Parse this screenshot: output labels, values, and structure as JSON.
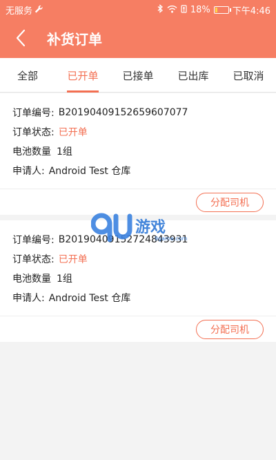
{
  "status_bar": {
    "carrier": "无服务",
    "battery_percent": "18%",
    "battery_level": 0.18,
    "time": "下午4:46"
  },
  "header": {
    "title": "补货订单"
  },
  "tabs": [
    {
      "label": "全部",
      "active": false
    },
    {
      "label": "已开单",
      "active": true
    },
    {
      "label": "已接单",
      "active": false
    },
    {
      "label": "已出库",
      "active": false
    },
    {
      "label": "已取消",
      "active": false
    }
  ],
  "orders": [
    {
      "order_no_label": "订单编号:",
      "order_no": "B20190409152659607077",
      "status_label": "订单状态:",
      "status": "已开单",
      "battery_label": "电池数量",
      "battery_qty": "1组",
      "applicant_label": "申请人:",
      "applicant": "Android Test 仓库",
      "action_label": "分配司机"
    },
    {
      "order_no_label": "订单编号:",
      "order_no": "B20190409152724843931",
      "status_label": "订单状态:",
      "status": "已开单",
      "battery_label": "电池数量",
      "battery_qty": "1组",
      "applicant_label": "申请人:",
      "applicant": "Android Test 仓库",
      "action_label": "分配司机"
    }
  ],
  "watermark": {
    "text": "游戏",
    "sub": "9game.com"
  },
  "colors": {
    "header_bg": "#f67e63",
    "accent": "#f36f52",
    "page_bg": "#f3f3f3"
  }
}
